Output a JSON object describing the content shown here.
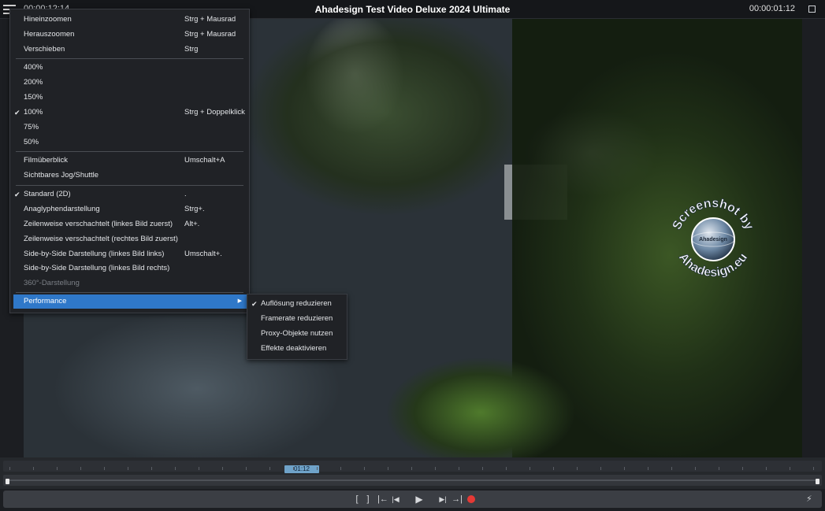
{
  "app": {
    "title": "Ahadesign Test Video Deluxe 2024 Ultimate",
    "timecode_left": "00:00:12:14",
    "timecode_right": "00:00:01:12"
  },
  "menu": {
    "items": [
      {
        "label": "Hineinzoomen",
        "shortcut": "Strg + Mausrad",
        "checked": false
      },
      {
        "label": "Herauszoomen",
        "shortcut": "Strg + Mausrad",
        "checked": false
      },
      {
        "label": "Verschieben",
        "shortcut": "Strg",
        "checked": false
      },
      {
        "label": "400%",
        "shortcut": "",
        "checked": false
      },
      {
        "label": "200%",
        "shortcut": "",
        "checked": false
      },
      {
        "label": "150%",
        "shortcut": "",
        "checked": false
      },
      {
        "label": "100%",
        "shortcut": "Strg + Doppelklick",
        "checked": true
      },
      {
        "label": "75%",
        "shortcut": "",
        "checked": false
      },
      {
        "label": "50%",
        "shortcut": "",
        "checked": false
      },
      {
        "label": "Filmüberblick",
        "shortcut": "Umschalt+A",
        "checked": false
      },
      {
        "label": "Sichtbares Jog/Shuttle",
        "shortcut": "",
        "checked": false
      },
      {
        "label": "Standard (2D)",
        "shortcut": ".",
        "checked": true
      },
      {
        "label": "Anaglyphendarstellung",
        "shortcut": "Strg+.",
        "checked": false
      },
      {
        "label": "Zeilenweise verschachtelt (linkes Bild zuerst)",
        "shortcut": "Alt+.",
        "checked": false
      },
      {
        "label": "Zeilenweise verschachtelt (rechtes Bild zuerst)",
        "shortcut": "",
        "checked": false
      },
      {
        "label": "Side-by-Side Darstellung (linkes Bild links)",
        "shortcut": "Umschalt+.",
        "checked": false
      },
      {
        "label": "Side-by-Side Darstellung (linkes Bild rechts)",
        "shortcut": "",
        "checked": false
      },
      {
        "label": "360°-Darstellung",
        "shortcut": "",
        "checked": false,
        "disabled": true
      },
      {
        "label": "Performance",
        "shortcut": "",
        "checked": false,
        "highlighted": true,
        "has_submenu": true
      }
    ]
  },
  "submenu": {
    "items": [
      {
        "label": "Auflösung reduzieren",
        "checked": true
      },
      {
        "label": "Framerate reduzieren",
        "checked": false
      },
      {
        "label": "Proxy-Objekte nutzen",
        "checked": false
      },
      {
        "label": "Effekte deaktivieren",
        "checked": false
      }
    ]
  },
  "timeline": {
    "clip_label": "01:12"
  },
  "transport": {
    "mark_in": "[",
    "mark_out": "]",
    "prev_marker": "|←",
    "to_start": "|◀",
    "play": "▶",
    "to_end": "▶|",
    "next_marker": "→|"
  },
  "watermark": {
    "text_top": "Screenshot by",
    "text_bottom": "Ahadesign.eu",
    "badge": "Ahadesign"
  },
  "colors": {
    "accent": "#2f78c9",
    "record": "#e53935",
    "clip_marker": "#6fa3c9"
  }
}
